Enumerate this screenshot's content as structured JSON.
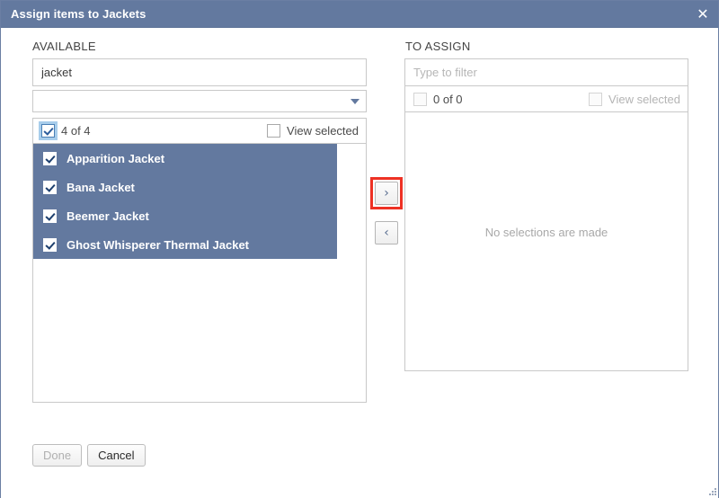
{
  "window": {
    "title": "Assign items to Jackets",
    "close_icon": "close-icon",
    "header_bg": "#63799f"
  },
  "available": {
    "label": "AVAILABLE",
    "filter_value": "jacket",
    "filter_placeholder": "",
    "category_select_value": "",
    "category_caret_icon": "chevron-down-icon",
    "select_all_checked": true,
    "count_label": "4 of 4",
    "view_selected_label": "View selected",
    "view_selected_checked": false,
    "items": [
      {
        "label": "Apparition Jacket",
        "checked": true,
        "selected": true
      },
      {
        "label": "Bana Jacket",
        "checked": true,
        "selected": true
      },
      {
        "label": "Beemer Jacket",
        "checked": true,
        "selected": true
      },
      {
        "label": "Ghost Whisperer Thermal Jacket",
        "checked": true,
        "selected": true
      }
    ]
  },
  "to_assign": {
    "label": "TO ASSIGN",
    "filter_value": "",
    "filter_placeholder": "Type to filter",
    "select_all_checked": false,
    "count_label": "0 of 0",
    "view_selected_label": "View selected",
    "view_selected_checked": false,
    "empty_message": "No selections are made",
    "items": []
  },
  "transfer": {
    "assign_icon": "chevron-right-icon",
    "assign_glyph": "›",
    "unassign_icon": "chevron-left-icon",
    "unassign_glyph": "‹",
    "highlight_color": "#ee3124"
  },
  "footer": {
    "done_label": "Done",
    "done_disabled": true,
    "cancel_label": "Cancel",
    "cancel_disabled": false
  }
}
